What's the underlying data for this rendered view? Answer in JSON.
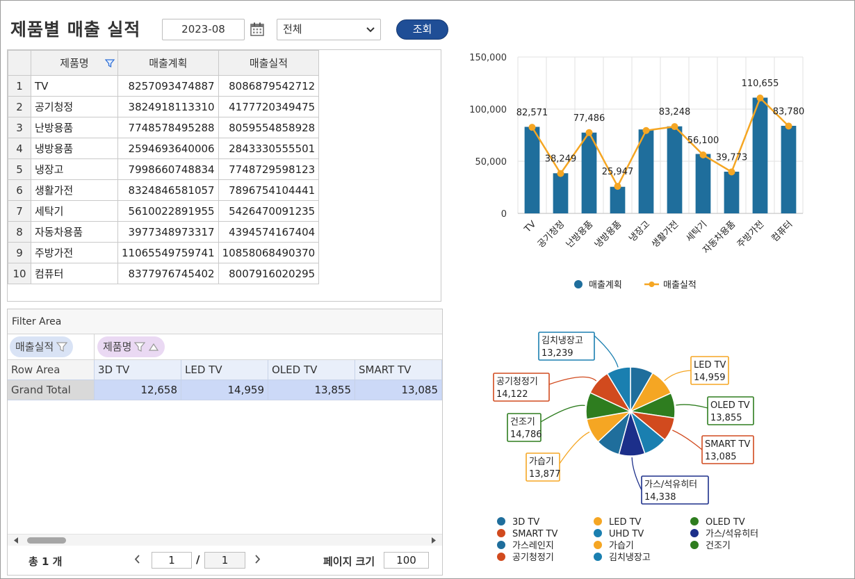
{
  "header": {
    "title": "제품별 매출 실적",
    "date": "2023-08",
    "select_value": "전체",
    "search_label": "조회"
  },
  "grid": {
    "columns": [
      "제품명",
      "매출계획",
      "매출실적"
    ],
    "rows": [
      {
        "no": "1",
        "name": "TV",
        "plan": "8257093474887",
        "actual": "8086879542712"
      },
      {
        "no": "2",
        "name": "공기청정",
        "plan": "3824918113310",
        "actual": "4177720349475"
      },
      {
        "no": "3",
        "name": "난방용품",
        "plan": "7748578495288",
        "actual": "8059554858928"
      },
      {
        "no": "4",
        "name": "냉방용품",
        "plan": "2594693640006",
        "actual": "2843330555501"
      },
      {
        "no": "5",
        "name": "냉장고",
        "plan": "7998660748834",
        "actual": "7748729598123"
      },
      {
        "no": "6",
        "name": "생활가전",
        "plan": "8324846581057",
        "actual": "7896754104441"
      },
      {
        "no": "7",
        "name": "세탁기",
        "plan": "5610022891955",
        "actual": "5426470091235"
      },
      {
        "no": "8",
        "name": "자동차용품",
        "plan": "3977348973317",
        "actual": "4394574167404"
      },
      {
        "no": "9",
        "name": "주방가전",
        "plan": "11065549759741",
        "actual": "10858068490370"
      },
      {
        "no": "10",
        "name": "컴퓨터",
        "plan": "8377976745402",
        "actual": "8007916020295"
      }
    ]
  },
  "pivot": {
    "filter_area_label": "Filter Area",
    "value_chip": "매출실적",
    "column_chip": "제품명",
    "row_area_label": "Row Area",
    "column_headers": [
      "3D TV",
      "LED TV",
      "OLED TV",
      "SMART TV"
    ],
    "grand_total_label": "Grand Total",
    "grand_total_values": [
      "12,658",
      "14,959",
      "13,855",
      "13,085"
    ]
  },
  "pager": {
    "total_text": "총  1 개",
    "current_page": "1",
    "total_pages": "1",
    "page_size_label": "페이지 크기",
    "page_size": "100"
  },
  "colors": {
    "bar": "#1f6e9c",
    "line": "#f5a623",
    "button": "#1f4e96"
  },
  "chart_data": [
    {
      "type": "bar",
      "categories": [
        "TV",
        "공기청정",
        "난방용품",
        "냉방용품",
        "냉장고",
        "생활가전",
        "세탁기",
        "자동차용품",
        "주방가전",
        "컴퓨터"
      ],
      "series": [
        {
          "name": "매출계획",
          "type": "bar",
          "values": [
            83000,
            38500,
            77500,
            25500,
            80500,
            83500,
            57000,
            40000,
            111000,
            84000
          ]
        },
        {
          "name": "매출실적",
          "type": "line",
          "values": [
            82571,
            38249,
            77486,
            25947,
            79500,
            83248,
            56100,
            39773,
            110655,
            83780
          ]
        }
      ],
      "data_labels": [
        "82,571",
        "38,249",
        "77,486",
        "25,947",
        "",
        "83,248",
        "56,100",
        "39,773",
        "110,655",
        "83,780"
      ],
      "yticks": [
        "0",
        "50,000",
        "100,000",
        "150,000"
      ],
      "ylim": [
        0,
        150000
      ],
      "legend": "bottom"
    },
    {
      "type": "pie",
      "labels": [
        "3D TV",
        "LED TV",
        "OLED TV",
        "SMART TV",
        "UHD TV",
        "가스/석유히터",
        "가스레인지",
        "가습기",
        "건조기",
        "공기청정기",
        "김치냉장고"
      ],
      "values": [
        12658,
        14959,
        13855,
        13085,
        13300,
        14338,
        13400,
        13877,
        14786,
        14122,
        13239
      ],
      "value_labels": [
        "",
        "14,959",
        "13,855",
        "13,085",
        "",
        "14,338",
        "",
        "13,877",
        "14,786",
        "14,122",
        "13,239"
      ],
      "colors": [
        "#1f6e9c",
        "#f5a623",
        "#2e7d1f",
        "#d14a1e",
        "#1a7fb0",
        "#1c2f8a",
        "#1f6e9c",
        "#f5a623",
        "#2e7d1f",
        "#d14a1e",
        "#1a7fb0"
      ],
      "legend": "bottom"
    }
  ]
}
